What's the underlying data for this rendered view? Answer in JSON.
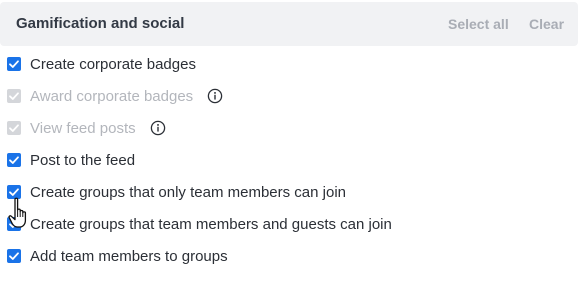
{
  "header": {
    "title": "Gamification and social",
    "select_all_label": "Select all",
    "clear_label": "Clear"
  },
  "options": [
    {
      "label": "Create corporate badges",
      "checked": true,
      "disabled": false,
      "info": false
    },
    {
      "label": "Award corporate badges",
      "checked": true,
      "disabled": true,
      "info": true
    },
    {
      "label": "View feed posts",
      "checked": true,
      "disabled": true,
      "info": true
    },
    {
      "label": "Post to the feed",
      "checked": true,
      "disabled": false,
      "info": false
    },
    {
      "label": "Create groups that only team members can join",
      "checked": true,
      "disabled": false,
      "info": false
    },
    {
      "label": "Create groups that team members and guests can join",
      "checked": true,
      "disabled": false,
      "info": false
    },
    {
      "label": "Add team members to groups",
      "checked": true,
      "disabled": false,
      "info": false
    }
  ],
  "colors": {
    "checkbox_active": "#1a73e8",
    "checkbox_disabled": "#d4d6da",
    "header_bg": "#f1f2f4"
  },
  "icons": {
    "check": "check-icon",
    "info": "info-icon",
    "cursor": "hand-pointer-icon"
  }
}
